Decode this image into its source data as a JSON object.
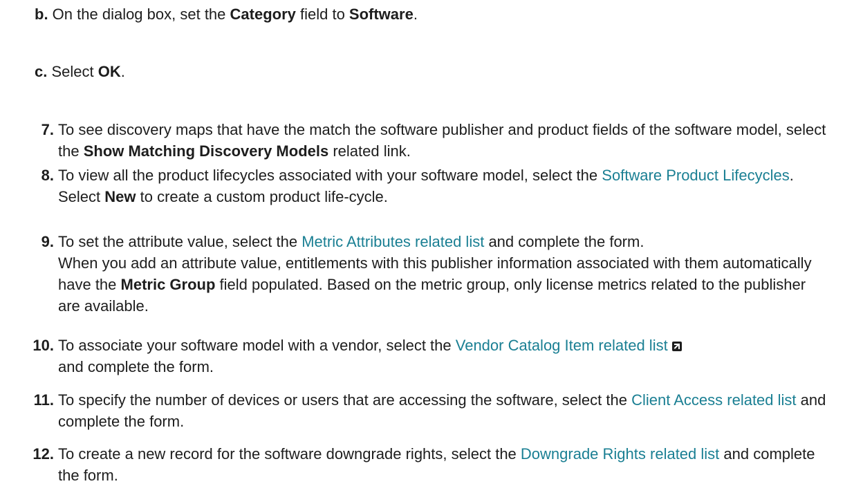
{
  "substeps": {
    "b": {
      "letter": "b.",
      "t1": " On the dialog box, set the ",
      "b1": "Category",
      "t2": " field to ",
      "b2": "Software",
      "t3": "."
    },
    "c": {
      "letter": "c.",
      "t1": " Select ",
      "b1": "OK",
      "t2": "."
    }
  },
  "steps": {
    "s7": {
      "num": "7.",
      "t1": "To see discovery maps that have the match the software publisher and product fields of the software model, select the ",
      "b1": "Show Matching Discovery Models",
      "t2": " related link."
    },
    "s8": {
      "num": "8.",
      "t1": "To view all the product lifecycles associated with your software model, select the ",
      "link": "Software Product Lifecycles",
      "t2": ".",
      "t3": "Select ",
      "b1": "New",
      "t4": " to create a custom product life-cycle."
    },
    "s9": {
      "num": "9.",
      "t1": "To set the attribute value, select the ",
      "link": "Metric Attributes related list",
      "t2": " and complete the form.",
      "t3": "When you add an attribute value, entitlements with this publisher information associated with them automatically have the ",
      "b1": "Metric Group",
      "t4": " field populated. Based on the metric group, only license metrics related to the publisher are available."
    },
    "s10": {
      "num": "10.",
      "t1": "To associate your software model with a vendor, select the  ",
      "link": "Vendor Catalog Item related list",
      "t2": " and complete the form."
    },
    "s11": {
      "num": "11.",
      "t1": "To specify the number of devices or users that are accessing the software, select the ",
      "link": "Client Access related list",
      "t2": " and complete the form."
    },
    "s12": {
      "num": "12.",
      "t1": "To create a new record for the software downgrade rights, select the ",
      "link": "Downgrade Rights related list",
      "t2": " and complete the form."
    }
  },
  "icons": {
    "external_link": "external-link-icon"
  },
  "colors": {
    "text": "#1d1d1d",
    "link": "#1a7f93"
  }
}
